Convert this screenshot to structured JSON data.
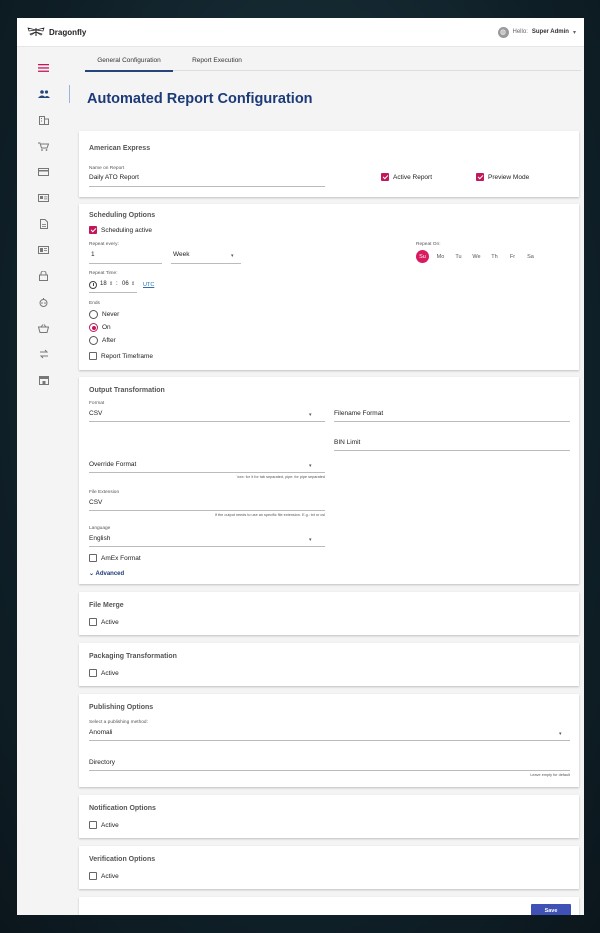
{
  "app": {
    "brand": "Dragonfly",
    "user_greeting": "Hello:",
    "user_name": "Super Admin"
  },
  "icons": {
    "menu": "hamburger-icon",
    "users": "users-icon",
    "building": "building-icon",
    "cart": "cart-icon",
    "card": "credit-card-icon",
    "id": "id-card-icon",
    "doc": "document-icon",
    "book": "book-icon",
    "lock": "lock-icon",
    "robot": "robot-icon",
    "basket": "basket-icon",
    "arrows": "swap-icon",
    "store": "store-icon"
  },
  "tabs": [
    "General Configuration",
    "Report Execution"
  ],
  "page_title": "Automated Report Configuration",
  "company": {
    "title": "American Express",
    "name_label": "Name on Report",
    "name_value": "Daily ATO Report",
    "active_report": "Active Report",
    "preview_mode": "Preview Mode"
  },
  "scheduling": {
    "title": "Scheduling Options",
    "active_label": "Scheduling active",
    "repeat_every_label": "Repeat every:",
    "repeat_every_value": "1",
    "repeat_unit": "Week",
    "repeat_on_label": "Repeat On:",
    "days": [
      "Su",
      "Mo",
      "Tu",
      "We",
      "Th",
      "Fr",
      "Sa"
    ],
    "repeat_time_label": "Repeat Time:",
    "hour": "18",
    "minute": "06",
    "timezone": "UTC",
    "ends_label": "Ends",
    "ends_options": [
      "Never",
      "On",
      "After"
    ],
    "report_timeframe": "Report Timeframe"
  },
  "output": {
    "title": "Output Transformation",
    "format_label": "Format",
    "format_value": "CSV",
    "filename_format": "Filename Format",
    "bin_limit": "BIN Limit",
    "override_format": "Override Format",
    "override_hint": "\\xxx: for \\t for tab separated, pipe: for pipe separated",
    "file_ext_label": "File Extension",
    "file_ext_value": "CSV",
    "file_ext_hint": "If the output needs to use an specific file extension. E.g.: txt or csl",
    "language_label": "Language",
    "language_value": "English",
    "amex_format": "AmEx Format",
    "advanced": "Advanced"
  },
  "file_merge": {
    "title": "File Merge",
    "active": "Active"
  },
  "packaging": {
    "title": "Packaging Transformation",
    "active": "Active"
  },
  "publishing": {
    "title": "Publishing Options",
    "method_label": "Select a publishing method:",
    "method_value": "Anomali",
    "directory": "Directory",
    "directory_hint": "Leave empty for default"
  },
  "notification": {
    "title": "Notification Options",
    "active": "Active"
  },
  "verification": {
    "title": "Verification Options",
    "active": "Active"
  },
  "footer": {
    "save": "Save"
  },
  "colors": {
    "primary": "#1c3a78",
    "accent": "#d81b60",
    "button": "#3f51b5"
  }
}
